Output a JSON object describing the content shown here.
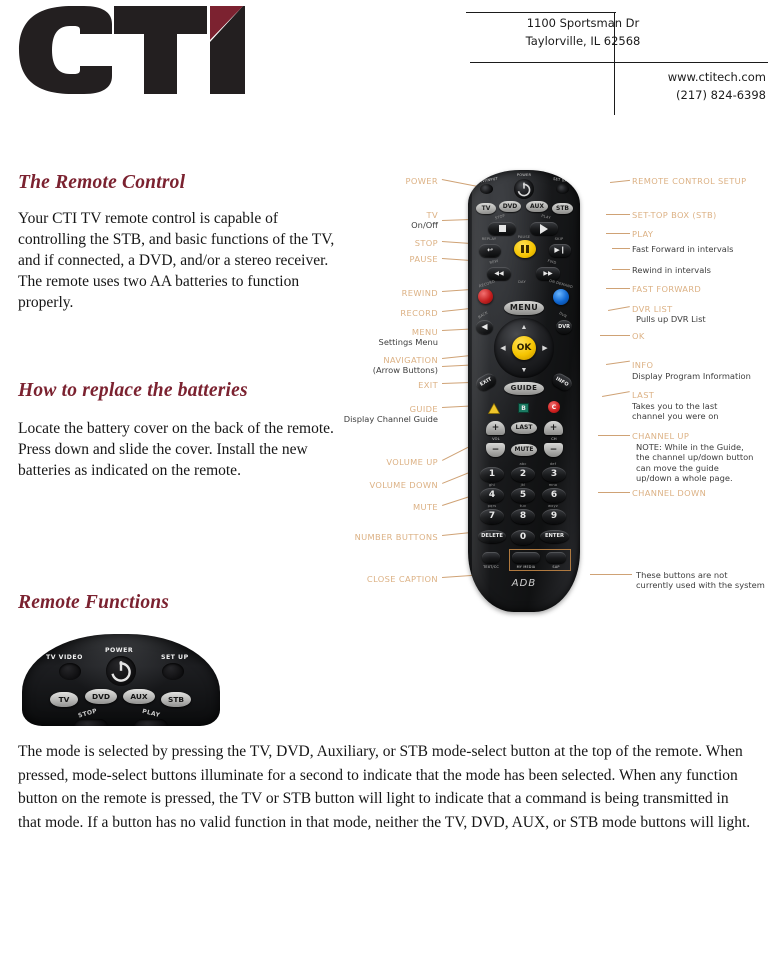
{
  "header": {
    "logo_text": "CTI",
    "logo_dark": "#231f20",
    "logo_accent": "#7c2230",
    "address_line1": "1100 Sportsman Dr",
    "address_line2": "Taylorville, IL 62568",
    "website": "www.ctitech.com",
    "phone": "(217) 824-6398"
  },
  "sections": {
    "remote_control": {
      "heading": "The Remote Control",
      "body": "Your CTI TV remote control is capable of controlling the STB, and basic functions of the TV, and if connected, a DVD, and/or a stereo receiver. The remote uses two AA batteries to function properly."
    },
    "batteries": {
      "heading": "How to replace the batteries",
      "body": "Locate the battery cover on the back of the remote. Press down and slide the cover. Install the new batteries as indicated on the remote."
    },
    "functions": {
      "heading": "Remote Functions",
      "body": "The mode is selected by pressing the TV, DVD, Auxiliary, or STB mode-select button at the top of the remote. When pressed, mode-select buttons illuminate for a second to indicate that the mode has been selected. When any function button on the remote is pressed, the TV or STB button will light to indicate that a command is being transmitted in that mode. If a button has no valid function in that mode, neither the TV, DVD, AUX, or STB mode buttons will light."
    }
  },
  "diagram": {
    "accent_color": "#dcb184",
    "leader_color": "#cfa275",
    "left_labels": [
      {
        "title": "POWER",
        "sub": ""
      },
      {
        "title": "TV",
        "sub": "On/Off"
      },
      {
        "title": "STOP",
        "sub": ""
      },
      {
        "title": "PAUSE",
        "sub": ""
      },
      {
        "title": "REWIND",
        "sub": ""
      },
      {
        "title": "RECORD",
        "sub": ""
      },
      {
        "title": "MENU",
        "sub": "Settings Menu"
      },
      {
        "title": "NAVIGATION",
        "sub": "(Arrow Buttons)"
      },
      {
        "title": "EXIT",
        "sub": ""
      },
      {
        "title": "GUIDE",
        "sub": "Display Channel Guide"
      },
      {
        "title": "VOLUME UP",
        "sub": ""
      },
      {
        "title": "VOLUME DOWN",
        "sub": ""
      },
      {
        "title": "MUTE",
        "sub": ""
      },
      {
        "title": "NUMBER BUTTONS",
        "sub": ""
      },
      {
        "title": "CLOSE CAPTION",
        "sub": ""
      }
    ],
    "right_labels": [
      {
        "title": "REMOTE CONTROL SETUP",
        "sub": ""
      },
      {
        "title": "SET-TOP BOX (STB)",
        "sub": ""
      },
      {
        "title": "PLAY",
        "sub": ""
      },
      {
        "title": "",
        "sub": "Fast Forward in intervals"
      },
      {
        "title": "",
        "sub": "Rewind in intervals"
      },
      {
        "title": "FAST FORWARD",
        "sub": ""
      },
      {
        "title": "DVR LIST",
        "sub": "Pulls up DVR List"
      },
      {
        "title": "OK",
        "sub": ""
      },
      {
        "title": "INFO",
        "sub": "Display Program Information"
      },
      {
        "title": "LAST",
        "sub": "Takes you to the last channel you were on"
      },
      {
        "title": "CHANNEL UP",
        "sub": "NOTE: While in the Guide, the channel up/down button can move the guide up/down a whole page."
      },
      {
        "title": "CHANNEL DOWN",
        "sub": ""
      },
      {
        "title": "",
        "sub": "These buttons are not currently used with the system"
      }
    ],
    "remote": {
      "brand": "ADB",
      "top_micro": [
        "TV/INPUT",
        "POWER",
        "SET UP"
      ],
      "mode_buttons": [
        "TV",
        "DVD",
        "AUX",
        "STB"
      ],
      "transport_micro": [
        "STOP",
        "PLAY",
        "REPLAY",
        "PAUSE",
        "SKIP",
        "REW",
        "FWD",
        "DAY",
        "RECORD",
        "BACK",
        "ON DEMAND"
      ],
      "menu_label": "MENU",
      "ok_label": "OK",
      "exit_label": "EXIT",
      "guide_label": "GUIDE",
      "info_label": "INFO",
      "dvr_label": "DVR",
      "color_buttons": [
        "A",
        "B",
        "C"
      ],
      "vol_label": "VOL",
      "ch_label": "CH",
      "last_label": "LAST",
      "mute_label": "MUTE",
      "keypad": [
        {
          "num": "1",
          "alpha": ""
        },
        {
          "num": "2",
          "alpha": "abc"
        },
        {
          "num": "3",
          "alpha": "def"
        },
        {
          "num": "4",
          "alpha": "ghi"
        },
        {
          "num": "5",
          "alpha": "jkl"
        },
        {
          "num": "6",
          "alpha": "mno"
        },
        {
          "num": "7",
          "alpha": "pqrs"
        },
        {
          "num": "8",
          "alpha": "tuv"
        },
        {
          "num": "9",
          "alpha": "wxyz"
        },
        {
          "num": "0",
          "alpha": ""
        }
      ],
      "delete_label": "DELETE",
      "enter_label": "ENTER",
      "bottom_row": [
        "TEXT/CC",
        "MY MEDIA",
        "SAP"
      ],
      "highlight_color": "#b07a40"
    }
  },
  "remote_top_detail": {
    "labels": [
      "TV VIDEO",
      "POWER",
      "SET UP"
    ],
    "mode_buttons": [
      "TV",
      "DVD",
      "AUX",
      "STB"
    ],
    "sub_labels": [
      "STOP",
      "PLAY"
    ],
    "power_icon": "power-icon"
  }
}
